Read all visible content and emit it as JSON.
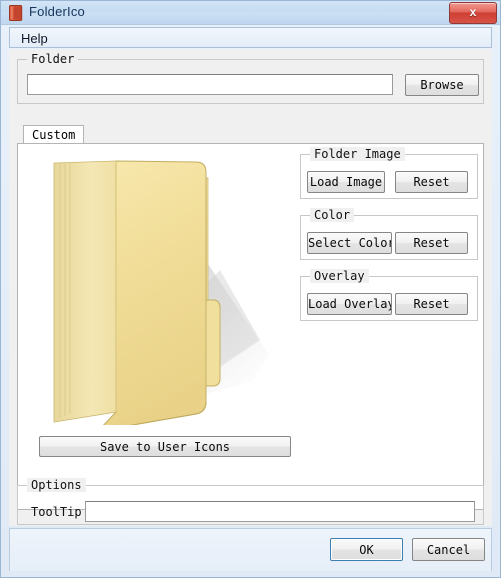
{
  "window": {
    "title": "FolderIco",
    "icon": "folder-app-icon",
    "close_label": "x"
  },
  "menubar": {
    "items": [
      {
        "label": "Help",
        "name": "menu-item-help"
      }
    ]
  },
  "folder_group": {
    "title": "Folder",
    "path_value": "",
    "path_placeholder": "",
    "browse_label": "Browse"
  },
  "tabs": [
    {
      "label": "Custom",
      "name": "tab-custom",
      "selected": true
    }
  ],
  "folder_image_group": {
    "title": "Folder Image",
    "load_label": "Load Image",
    "reset_label": "Reset"
  },
  "color_group": {
    "title": "Color",
    "select_label": "Select Color",
    "reset_label": "Reset"
  },
  "overlay_group": {
    "title": "Overlay",
    "load_label": "Load Overlay",
    "reset_label": "Reset"
  },
  "save_button": {
    "label": "Save to User Icons"
  },
  "options_group": {
    "title": "Options",
    "tooltip_label": "ToolTip",
    "tooltip_value": "",
    "tooltip_placeholder": ""
  },
  "footer": {
    "ok_label": "OK",
    "cancel_label": "Cancel"
  },
  "preview": {
    "icon_name": "open-folder-icon",
    "description": "Windows open folder icon, yellow with white document and blue tab"
  },
  "colors": {
    "titlebar_top": "#d3e5f7",
    "titlebar_bottom": "#bed6ef",
    "close_button": "#cf3f33",
    "window_border": "#9bb6d2",
    "client_bg": "#f0f0f0",
    "tab_page_bg": "#ffffff",
    "folder_body": "#f3e1a0",
    "folder_front": "#ecd98f",
    "folder_edge": "#b8a44f",
    "folder_tab_blue": "#4aa3e8",
    "default_button_border": "#3c7fb1"
  }
}
